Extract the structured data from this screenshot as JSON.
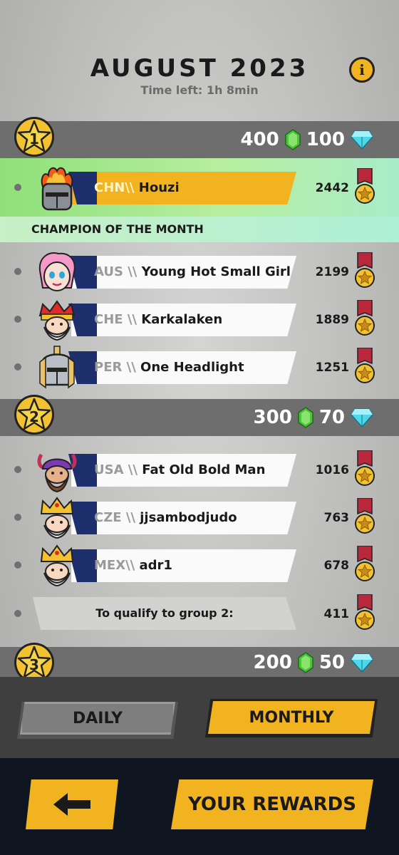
{
  "header": {
    "title": "AUGUST 2023",
    "time_left": "Time left: 1h 8min"
  },
  "groups": [
    {
      "rank": "1",
      "coins": "400",
      "gems": "100"
    },
    {
      "rank": "2",
      "coins": "300",
      "gems": "70"
    },
    {
      "rank": "3",
      "coins": "200",
      "gems": "50"
    }
  ],
  "champion_label": "CHAMPION OF THE MONTH",
  "players": [
    {
      "country": "CHN\\\\",
      "name": "Houzi",
      "score": "2442",
      "avatar": "flame-knight-avatar"
    },
    {
      "country": "AUS \\\\",
      "name": "Young Hot Small Girl",
      "score": "2199",
      "avatar": "pink-hair-girl-avatar"
    },
    {
      "country": "CHE \\\\",
      "name": "Karkalaken",
      "score": "1889",
      "avatar": "red-crown-king-avatar"
    },
    {
      "country": "PER \\\\",
      "name": "One Headlight",
      "score": "1251",
      "avatar": "knight-helmet-avatar"
    },
    {
      "country": "USA \\\\",
      "name": "Fat Old Bold Man",
      "score": "1016",
      "avatar": "viking-purple-avatar"
    },
    {
      "country": "CZE  \\\\",
      "name": "jjsambodjudo",
      "score": "763",
      "avatar": "gold-crown-king-avatar"
    },
    {
      "country": "MEX\\\\",
      "name": "adr1",
      "score": "678",
      "avatar": "gold-crown-king-avatar"
    }
  ],
  "qualify": {
    "label": "To qualify to group 2:",
    "score": "411"
  },
  "tabs": {
    "daily": "DAILY",
    "monthly": "MONTHLY",
    "active": "monthly"
  },
  "footer": {
    "rewards_label": "YOUR REWARDS",
    "back_icon": "arrow-left-icon"
  },
  "colors": {
    "accent": "#f2b320",
    "dark_bar": "#6e6e6e",
    "footer_bg": "#0f1521",
    "champion_green": "#8fe07a"
  }
}
